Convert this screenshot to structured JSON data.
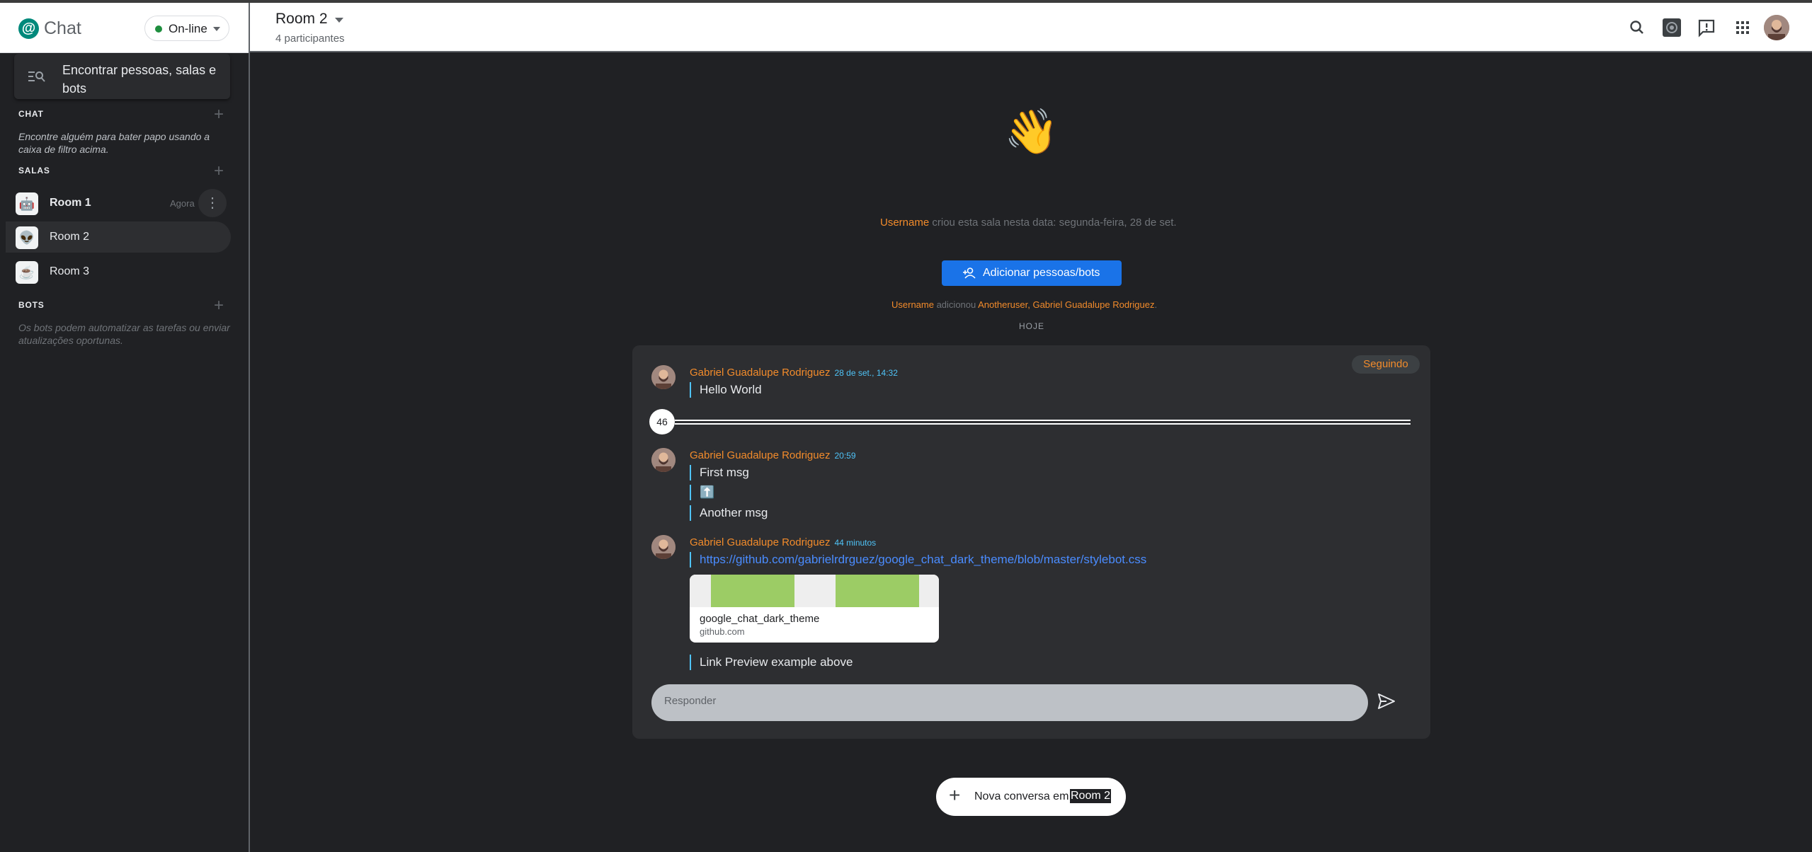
{
  "app": {
    "name": "Chat",
    "status": "On-line"
  },
  "sidebar": {
    "search_placeholder": "Encontrar pessoas, salas e bots",
    "chat_section": {
      "label": "CHAT",
      "hint": "Encontre alguém para bater papo usando a caixa de filtro acima."
    },
    "rooms_section": {
      "label": "SALAS"
    },
    "rooms": [
      {
        "name": "Room 1",
        "icon": "🤖",
        "time": "Agora",
        "unread": true
      },
      {
        "name": "Room 2",
        "icon": "👽",
        "selected": true
      },
      {
        "name": "Room 3",
        "icon": "☕"
      }
    ],
    "bots_section": {
      "label": "BOTS",
      "hint": "Os bots podem automatizar as tarefas ou enviar atualizações oportunas."
    }
  },
  "header": {
    "room_title": "Room 2",
    "participants": "4 participantes"
  },
  "main": {
    "wave_emoji": "👋",
    "created": {
      "user": "Username",
      "text": " criou esta sala nesta data: segunda-feira, 28 de set."
    },
    "add_button": "Adicionar pessoas/bots",
    "added": {
      "user": "Username",
      "verb": " adicionou ",
      "names": "Anotheruser, Gabriel Guadalupe Rodriguez",
      "trail": "."
    },
    "today_label": "HOJE",
    "thread": {
      "following_label": "Seguindo",
      "messages": [
        {
          "author": "Gabriel Guadalupe Rodriguez",
          "time": "28 de set., 14:32",
          "lines": [
            "Hello World"
          ]
        },
        {
          "author": "Gabriel Guadalupe Rodriguez",
          "time": "20:59",
          "lines": [
            "First msg",
            "⬆️",
            "Another msg"
          ]
        },
        {
          "author": "Gabriel Guadalupe Rodriguez",
          "time": "44 minutos",
          "link": "https://github.com/gabrielrdrguez/google_chat_dark_theme/blob/master/stylebot.css",
          "preview": {
            "title": "google_chat_dark_theme",
            "domain": "github.com"
          },
          "after": "Link Preview example above"
        }
      ],
      "unread_count": "46",
      "reply_placeholder": "Responder"
    },
    "new_conversation": {
      "text": "Nova conversa em ",
      "room": "Room 2"
    }
  },
  "colors": {
    "accent_orange": "#f28b2b",
    "timestamp_cyan": "#4fc3f7",
    "primary_blue": "#1a73e8",
    "online_green": "#1e8e3e"
  }
}
